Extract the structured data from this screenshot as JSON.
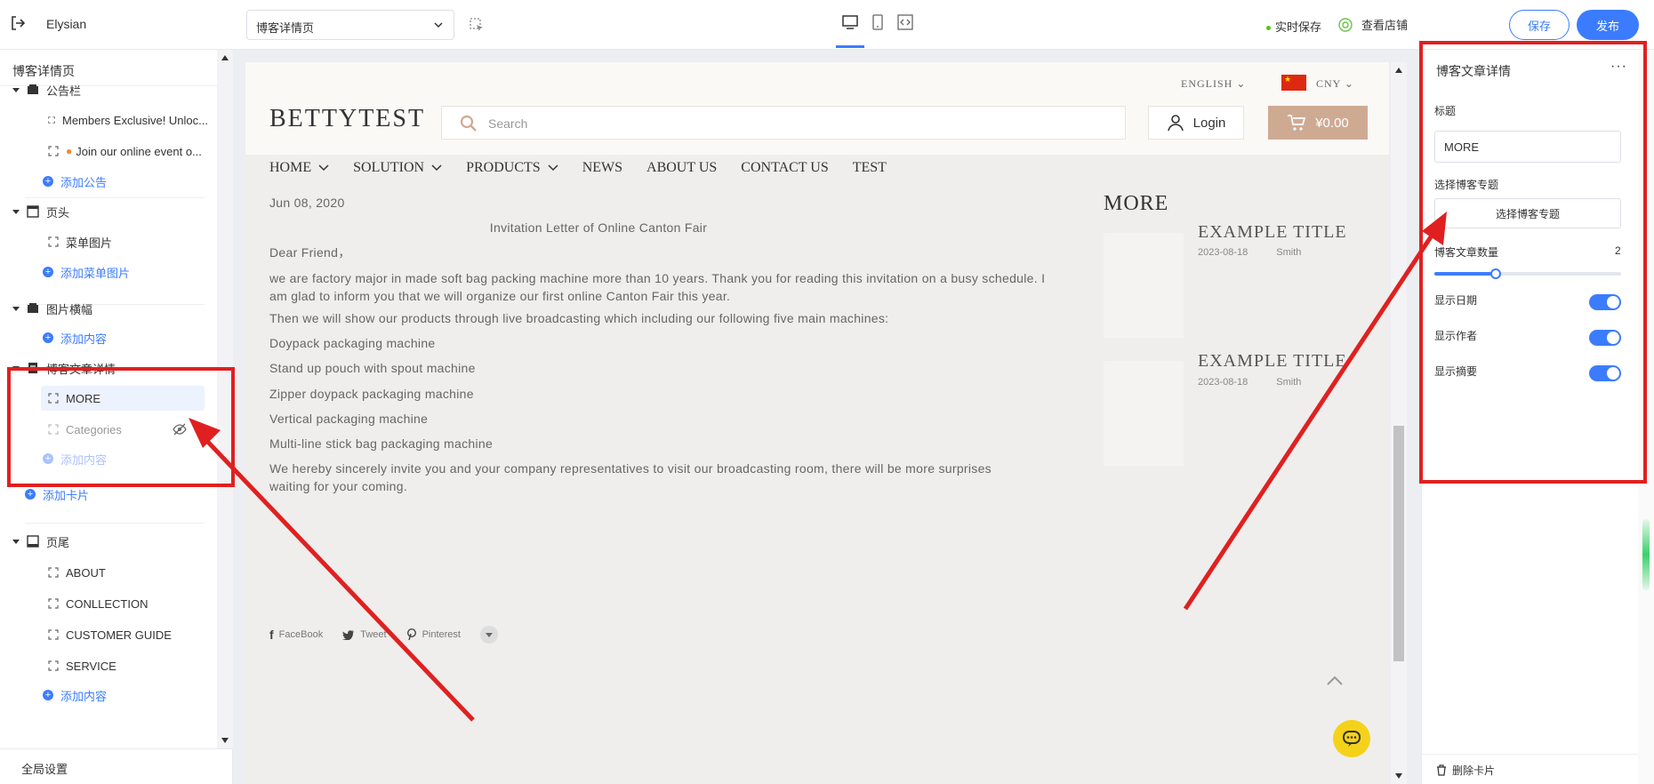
{
  "topbar": {
    "brand": "Elysian",
    "page_select": "博客详情页",
    "autosave": "实时保存",
    "view_store": "查看店铺",
    "save": "保存",
    "publish": "发布"
  },
  "left": {
    "title": "博客详情页",
    "announcement": "公告栏",
    "ann_items": [
      "Members Exclusive! Unloc...",
      "Join our online event o..."
    ],
    "add_announcement": "添加公告",
    "header": "页头",
    "header_item": "菜单图片",
    "add_header_item": "添加菜单图片",
    "banner": "图片横幅",
    "add_content": "添加内容",
    "blog_detail": "博客文章详情",
    "blog_items": [
      "MORE",
      "Categories"
    ],
    "add_card": "添加卡片",
    "footer": "页尾",
    "footer_items": [
      "ABOUT",
      "CONLLECTION",
      "CUSTOMER GUIDE",
      "SERVICE"
    ],
    "global_settings": "全局设置"
  },
  "site": {
    "language": "ENGLISH",
    "currency": "CNY",
    "logo": "BETTYTEST",
    "search_placeholder": "Search",
    "login": "Login",
    "cart": "¥0.00",
    "nav": [
      {
        "label": "HOME",
        "dropdown": true
      },
      {
        "label": "SOLUTION",
        "dropdown": true
      },
      {
        "label": "PRODUCTS",
        "dropdown": true
      },
      {
        "label": "NEWS",
        "dropdown": false
      },
      {
        "label": "ABOUT US",
        "dropdown": false
      },
      {
        "label": "CONTACT US",
        "dropdown": false
      },
      {
        "label": "TEST",
        "dropdown": false
      }
    ],
    "post": {
      "date": "Jun 08, 2020",
      "title": "Invitation Letter of Online Canton Fair",
      "greeting": "Dear Friend，",
      "paragraphs": [
        "we are factory major in made soft bag packing machine more than 10 years. Thank you for reading this invitation on a busy schedule. I am glad to inform you that we will organize our first online Canton Fair this year.",
        "Then we will show our products through live broadcasting which including our following five main machines:",
        "Doypack packaging machine",
        "Stand up pouch with spout machine",
        "Zipper doypack packaging machine",
        "Vertical packaging machine",
        "Multi-line stick bag packaging machine",
        "We hereby sincerely invite you and your company representatives to visit our broadcasting room, there will be more surprises waiting for your coming."
      ]
    },
    "more_title": "MORE",
    "more_cards": [
      {
        "title": "EXAMPLE TITLE",
        "date": "2023-08-18",
        "author": "Smith"
      },
      {
        "title": "EXAMPLE TITLE",
        "date": "2023-08-18",
        "author": "Smith"
      }
    ],
    "share": [
      "FaceBook",
      "Tweet",
      "Pinterest"
    ]
  },
  "panel": {
    "title": "博客文章详情",
    "title_label": "标题",
    "title_value": "MORE",
    "topic_label": "选择博客专题",
    "topic_button": "选择博客专题",
    "count_label": "博客文章数量",
    "count_value": "2",
    "count_fraction": 0.33,
    "show_date": "显示日期",
    "show_author": "显示作者",
    "show_summary": "显示摘要",
    "toggles": {
      "show_date": true,
      "show_author": true,
      "show_summary": true
    },
    "delete_card": "删除卡片"
  },
  "colors": {
    "accent": "#3b7cff",
    "annotation": "#e02020",
    "cart": "#cfaa93"
  }
}
